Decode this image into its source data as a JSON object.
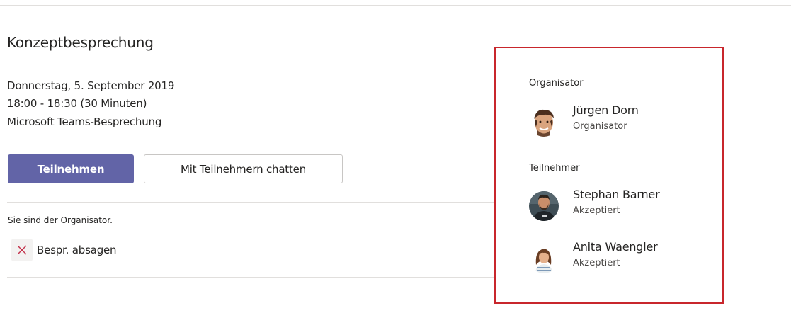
{
  "meeting": {
    "title": "Konzeptbesprechung",
    "date": "Donnerstag, 5. September 2019",
    "time": "18:00 - 18:30 (30 Minuten)",
    "type": "Microsoft Teams-Besprechung"
  },
  "actions": {
    "join_label": "Teilnehmen",
    "chat_label": "Mit Teilnehmern chatten",
    "organizer_note": "Sie sind der Organisator.",
    "cancel_label": "Bespr. absagen",
    "cancel_icon": "close-icon",
    "cancel_icon_color": "#c4314b"
  },
  "colors": {
    "accent": "#6264a7",
    "highlight_border": "#c8262c"
  },
  "panel": {
    "organizer_section": "Organisator",
    "participants_section": "Teilnehmer",
    "organizer": {
      "name": "Jürgen Dorn",
      "role": "Organisator",
      "avatar": "avatar-photo"
    },
    "participants": [
      {
        "name": "Stephan Barner",
        "status": "Akzeptiert",
        "avatar": "avatar-photo"
      },
      {
        "name": "Anita Waengler",
        "status": "Akzeptiert",
        "avatar": "avatar-photo"
      }
    ]
  }
}
